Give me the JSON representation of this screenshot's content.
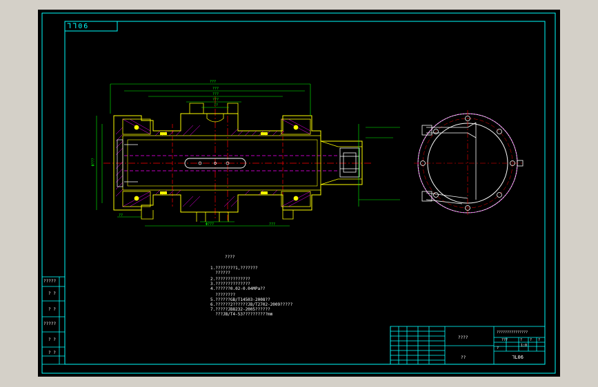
{
  "drawing": {
    "corner_code": "ᒣᒣ06",
    "colors": {
      "background": "#000000",
      "frame": "#00ffff",
      "outline": "#ffff00",
      "hatch": "#ff00ff",
      "center": "#ff0000",
      "dimension": "#00ff00",
      "text": "#ffffff"
    }
  },
  "notes": {
    "heading": "????",
    "lines": [
      "1.????????1,???????",
      "  ??????",
      "2.??????????????",
      "3.??????????????",
      "4.??????0.02-0.04MPa??",
      "  ????????",
      "5.??????GB/T14503-2008??",
      "6.??????2??????JB/T2702-2009?????",
      "7.?????JB8232-2005??????",
      "  ???JB/T4-53??????????mm"
    ]
  },
  "side_labels": [
    "?????",
    "? ?",
    "? ?",
    "?????",
    "? ?",
    "? ?"
  ],
  "title_block": {
    "title_placeholder": "????",
    "sub_placeholder": "??",
    "right_header": "???????????????",
    "grid_labels": [
      "???",
      "?",
      "?",
      "?",
      "?"
    ],
    "scale": "1:0",
    "drawing_number": "ᒣL06"
  },
  "dimensions": {
    "top": [
      "???",
      "???",
      "???",
      "???",
      "??"
    ],
    "bottom": [
      "??",
      "Φ???",
      "???"
    ],
    "left": "Φ???"
  }
}
